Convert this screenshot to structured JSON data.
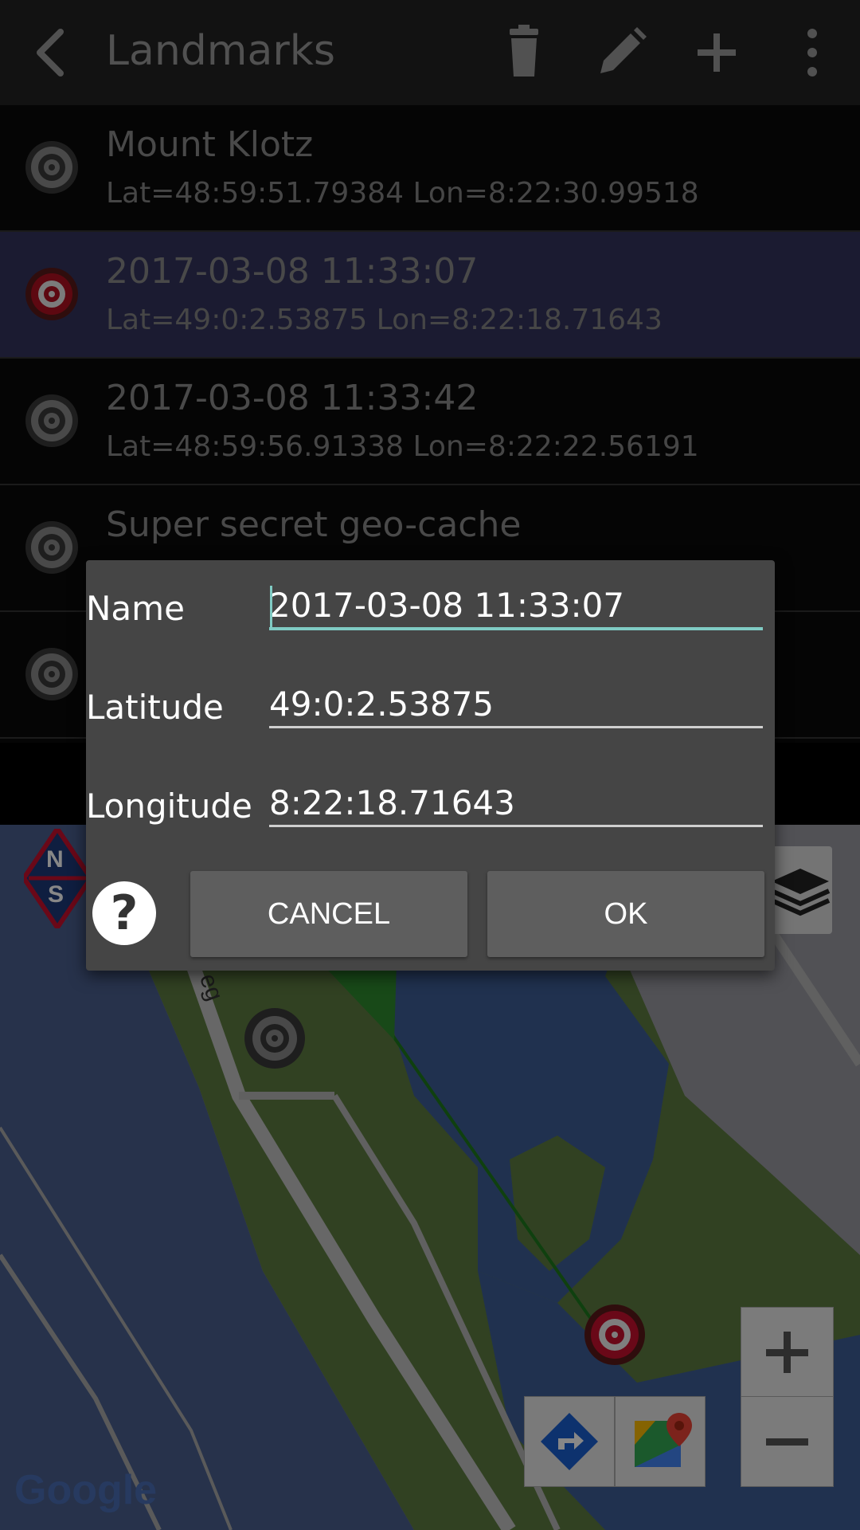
{
  "appbar": {
    "title": "Landmarks"
  },
  "landmarks": [
    {
      "name": "Mount Klotz",
      "coord": "Lat=48:59:51.79384 Lon=8:22:30.99518",
      "selected": false
    },
    {
      "name": "2017-03-08 11:33:07",
      "coord": "Lat=49:0:2.53875 Lon=8:22:18.71643",
      "selected": true
    },
    {
      "name": "2017-03-08 11:33:42",
      "coord": "Lat=48:59:56.91338 Lon=8:22:22.56191",
      "selected": false
    },
    {
      "name": "Super secret geo-cache",
      "coord": "",
      "selected": false
    },
    {
      "name": "",
      "coord": "",
      "selected": false
    }
  ],
  "map": {
    "street_fragment": "eg",
    "compass_n": "N",
    "compass_s": "S",
    "attribution": "Google"
  },
  "dialog": {
    "name_label": "Name",
    "name_value": "2017-03-08 11:33:07",
    "latitude_label": "Latitude",
    "latitude_value": "49:0:2.53875",
    "longitude_label": "Longitude",
    "longitude_value": "8:22:18.71643",
    "help_glyph": "?",
    "cancel_label": "CANCEL",
    "ok_label": "OK"
  },
  "colors": {
    "selected_row": "#33335e",
    "focus_underline": "#80cbc4",
    "map_water": "#3e5e95",
    "map_park": "#5d7c41",
    "target_red": "#c8102e"
  }
}
